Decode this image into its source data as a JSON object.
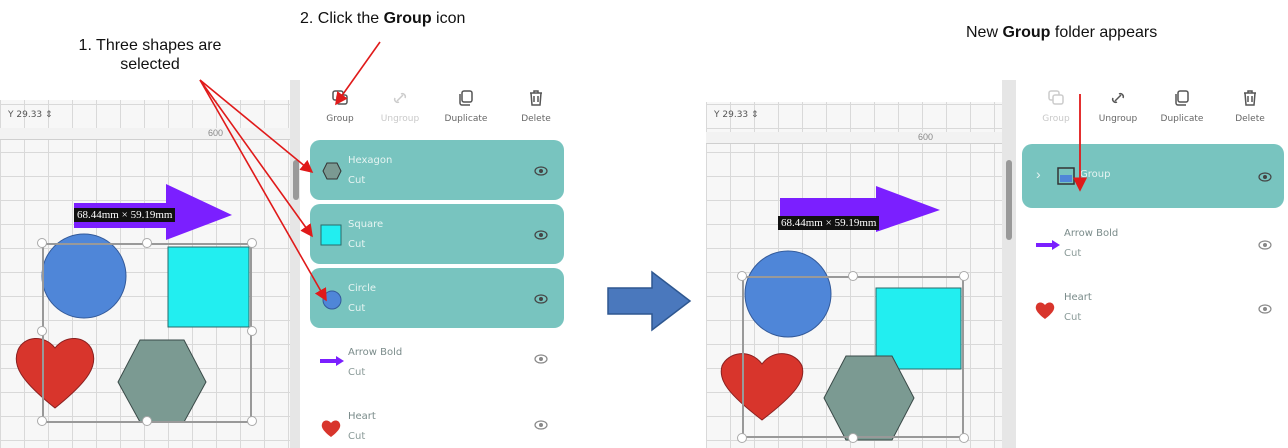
{
  "annotations": {
    "step1_line1": "1. Three shapes are",
    "step1_line2": "selected",
    "step2_prefix": "2. Click the ",
    "step2_bold": "Group",
    "step2_suffix": " icon",
    "after_prefix": "New ",
    "after_bold": "Group",
    "after_suffix": " folder appears"
  },
  "before": {
    "y_label": "Y",
    "y_value": "29.33",
    "ruler_mark": "600",
    "dimension_label": "68.44mm × 59.19mm",
    "toolbar": [
      {
        "label": "Group",
        "icon": "group-icon",
        "enabled": true
      },
      {
        "label": "Ungroup",
        "icon": "ungroup-icon",
        "enabled": false
      },
      {
        "label": "Duplicate",
        "icon": "duplicate-icon",
        "enabled": true
      },
      {
        "label": "Delete",
        "icon": "delete-icon",
        "enabled": true
      }
    ],
    "layers": [
      {
        "name": "Hexagon",
        "operation": "Cut",
        "selected": true,
        "icon": "hexagon-icon"
      },
      {
        "name": "Square",
        "operation": "Cut",
        "selected": true,
        "icon": "square-icon"
      },
      {
        "name": "Circle",
        "operation": "Cut",
        "selected": true,
        "icon": "circle-icon"
      },
      {
        "name": "Arrow Bold",
        "operation": "Cut",
        "selected": false,
        "icon": "arrow-icon"
      },
      {
        "name": "Heart",
        "operation": "Cut",
        "selected": false,
        "icon": "heart-icon"
      }
    ]
  },
  "after": {
    "y_label": "Y",
    "y_value": "29.33",
    "ruler_mark": "600",
    "dimension_label": "68.44mm × 59.19mm",
    "toolbar": [
      {
        "label": "Group",
        "icon": "group-icon",
        "enabled": false
      },
      {
        "label": "Ungroup",
        "icon": "ungroup-icon",
        "enabled": true
      },
      {
        "label": "Duplicate",
        "icon": "duplicate-icon",
        "enabled": true
      },
      {
        "label": "Delete",
        "icon": "delete-icon",
        "enabled": true
      }
    ],
    "layers": [
      {
        "name": "Group",
        "operation": "",
        "selected": true,
        "icon": "group-folder-icon"
      },
      {
        "name": "Arrow Bold",
        "operation": "Cut",
        "selected": false,
        "icon": "arrow-icon"
      },
      {
        "name": "Heart",
        "operation": "Cut",
        "selected": false,
        "icon": "heart-icon"
      }
    ]
  },
  "colors": {
    "selected_layer": "#78c4bf",
    "circle": "#4f86d8",
    "square": "#22eef0",
    "hexagon": "#7b9a92",
    "heart": "#d8352c",
    "arrow": "#7b1fff",
    "annotation_arrow": "#e01a1a",
    "transition_arrow": "#4a78bd"
  }
}
